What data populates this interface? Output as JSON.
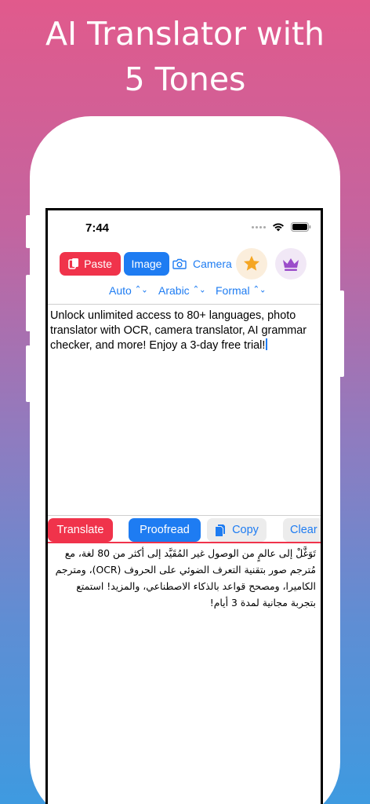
{
  "headline": {
    "line1": "AI Translator with",
    "line2": "5 Tones"
  },
  "status_bar": {
    "time": "7:44"
  },
  "toolbar": {
    "paste_label": "Paste",
    "image_label": "Image",
    "camera_label": "Camera"
  },
  "languages": {
    "source": "Auto",
    "target": "Arabic",
    "tone": "Formal"
  },
  "source_text": "Unlock unlimited access to 80+ languages, photo translator with OCR, camera translator, AI grammar checker, and more! Enjoy a 3-day free trial!",
  "actions": {
    "translate_label": "Translate",
    "proofread_label": "Proofread",
    "copy_label": "Copy",
    "clear_label": "Clear"
  },
  "translation": {
    "line1": "تَوَغَّلْ إلى عالمٍ من الوصول غير المُقَيَّد إلى أكثر من 80 لغة، مع",
    "line2": "مُترجم صور بتقنية التعرف الضوئي على الحروف (OCR)، ومترجم",
    "line3": "الكاميرا، ومصحح قواعد بالذكاء الاصطناعي، والمزيد! استمتع",
    "line4": "بتجربة مجانية لمدة 3 أيام!"
  },
  "colors": {
    "accent_red": "#F0334B",
    "accent_blue": "#1E7CF2",
    "star": "#F5A623",
    "crown": "#9B4DCA"
  },
  "icons": [
    "paste-icon",
    "camera-icon",
    "star-icon",
    "crown-icon",
    "copy-icon",
    "wifi-icon",
    "battery-icon",
    "cellular-dots-icon"
  ]
}
